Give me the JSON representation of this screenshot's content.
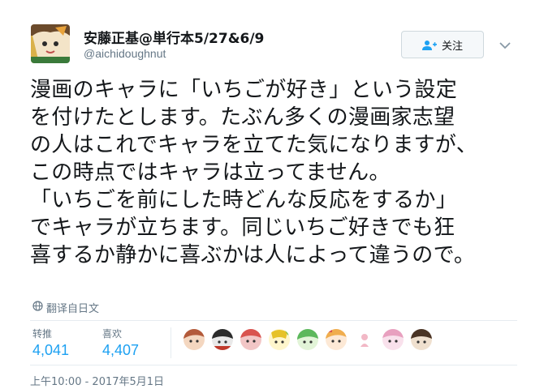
{
  "author": {
    "display_name": "安藤正基@単行本5/27&6/9",
    "handle": "@aichidoughnut"
  },
  "follow_button": {
    "label": "关注",
    "icon": "add-user-icon"
  },
  "menu": {
    "icon": "chevron-down-icon"
  },
  "tweet": {
    "lines": [
      "漫画のキャラに「いちごが好き」という設定",
      "を付けたとします。たぶん多くの漫画家志望",
      "の人はこれでキャラを立てた気になりますが、",
      "この時点ではキャラは立ってません。",
      "「いちごを前にした時どんな反応をするか」",
      "でキャラが立ちます。同じいちご好きでも狂",
      "喜するか静かに喜ぶかは人によって違うので。"
    ]
  },
  "translate": {
    "label": "翻译自日文",
    "icon": "globe-icon"
  },
  "stats": {
    "retweets": {
      "label": "转推",
      "value": "4,041"
    },
    "likes": {
      "label": "喜欢",
      "value": "4,407"
    }
  },
  "likers_count": 9,
  "timestamp": "上午10:00 - 2017年5月1日",
  "colors": {
    "link_blue": "#1da1f2",
    "muted_gray": "#657786",
    "border": "#e6ecf0"
  }
}
